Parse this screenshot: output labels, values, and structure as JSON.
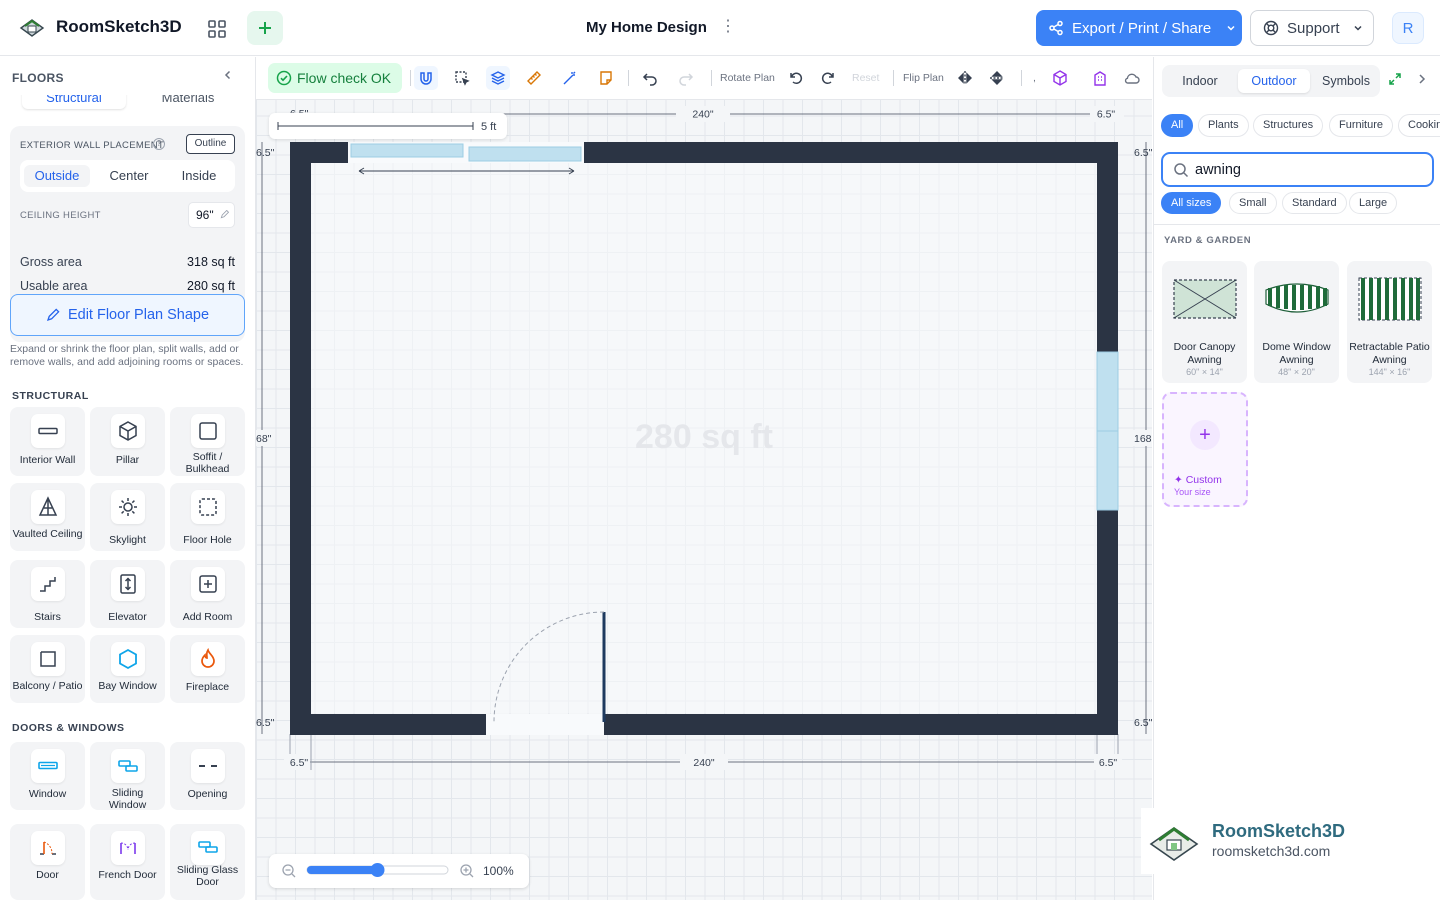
{
  "app": {
    "title": "RoomSketch3D",
    "design_title": "My Home Design",
    "user_initial": "R"
  },
  "header": {
    "export_label": "Export / Print / Share",
    "support_label": "Support"
  },
  "sidebar": {
    "title": "FLOORS",
    "tabs": [
      "Structural",
      "Materials"
    ],
    "exterior_wall_placement_label": "EXTERIOR WALL PLACEMENT",
    "outline_label": "Outline",
    "placement_options": [
      "Outside",
      "Center",
      "Inside"
    ],
    "selected_placement": "Outside",
    "ceiling_height_label": "CEILING HEIGHT",
    "ceiling_height_value": "96\"",
    "gross_area_label": "Gross area",
    "gross_area_value": "318 sq ft",
    "usable_area_label": "Usable area",
    "usable_area_value": "280 sq ft",
    "edit_button_label": "Edit Floor Plan Shape",
    "help_text": "Expand or shrink the floor plan, split walls, add or remove walls, and add adjoining rooms or spaces.",
    "structural_title": "STRUCTURAL",
    "structural_items": [
      {
        "label": "Interior Wall",
        "icon": "interior-wall-icon"
      },
      {
        "label": "Pillar",
        "icon": "pillar-icon"
      },
      {
        "label": "Soffit / Bulkhead",
        "icon": "soffit-icon"
      },
      {
        "label": "Vaulted Ceiling",
        "icon": "vaulted-ceiling-icon"
      },
      {
        "label": "Skylight",
        "icon": "skylight-icon"
      },
      {
        "label": "Floor Hole",
        "icon": "floor-hole-icon"
      },
      {
        "label": "Stairs",
        "icon": "stairs-icon"
      },
      {
        "label": "Elevator",
        "icon": "elevator-icon"
      },
      {
        "label": "Add Room",
        "icon": "add-room-icon"
      },
      {
        "label": "Balcony / Patio",
        "icon": "balcony-icon"
      },
      {
        "label": "Bay Window",
        "icon": "bay-window-icon"
      },
      {
        "label": "Fireplace",
        "icon": "fireplace-icon"
      }
    ],
    "doors_windows_title": "DOORS & WINDOWS",
    "doors_windows_items": [
      {
        "label": "Window",
        "icon": "window-icon"
      },
      {
        "label": "Sliding Window",
        "icon": "sliding-window-icon"
      },
      {
        "label": "Opening",
        "icon": "opening-icon"
      },
      {
        "label": "Door",
        "icon": "door-icon"
      },
      {
        "label": "French Door",
        "icon": "french-door-icon"
      },
      {
        "label": "Sliding Glass Door",
        "icon": "sliding-glass-door-icon"
      }
    ]
  },
  "toolbar": {
    "flow_check_label": "Flow check OK",
    "rotate_plan_label": "Rotate Plan",
    "reset_label": "Reset",
    "flip_plan_label": "Flip Plan"
  },
  "canvas": {
    "area_label": "280 sq ft",
    "scale_label": "5 ft",
    "dim_top_width": "240\"",
    "dim_bottom_width": "240\"",
    "dim_wall_thickness": "6.5\"",
    "dim_height_left": "68\"",
    "dim_height_right": "168",
    "zoom_percent": "100%",
    "zoom_level": 0.5
  },
  "right_panel": {
    "tabs": [
      "Indoor",
      "Outdoor",
      "Symbols"
    ],
    "active_tab": "Outdoor",
    "categories": [
      "All",
      "Plants",
      "Structures",
      "Furniture",
      "Cookin"
    ],
    "search_value": "awning",
    "sizes": [
      "All sizes",
      "Small",
      "Standard",
      "Large"
    ],
    "section_title": "YARD & GARDEN",
    "items": [
      {
        "name": "Door Canopy Awning",
        "size": "60\" × 14\""
      },
      {
        "name": "Dome Window Awning",
        "size": "48\" × 20\""
      },
      {
        "name": "Retractable Patio Awning",
        "size": "144\" × 16\""
      }
    ],
    "custom_label": "Custom",
    "custom_sub": "Your size"
  },
  "watermark": {
    "title": "RoomSketch3D",
    "url": "roomsketch3d.com"
  },
  "colors": {
    "accent": "#3b82f6",
    "wall": "#2b3444",
    "success": "#16a34a",
    "custom": "#9333ea"
  }
}
